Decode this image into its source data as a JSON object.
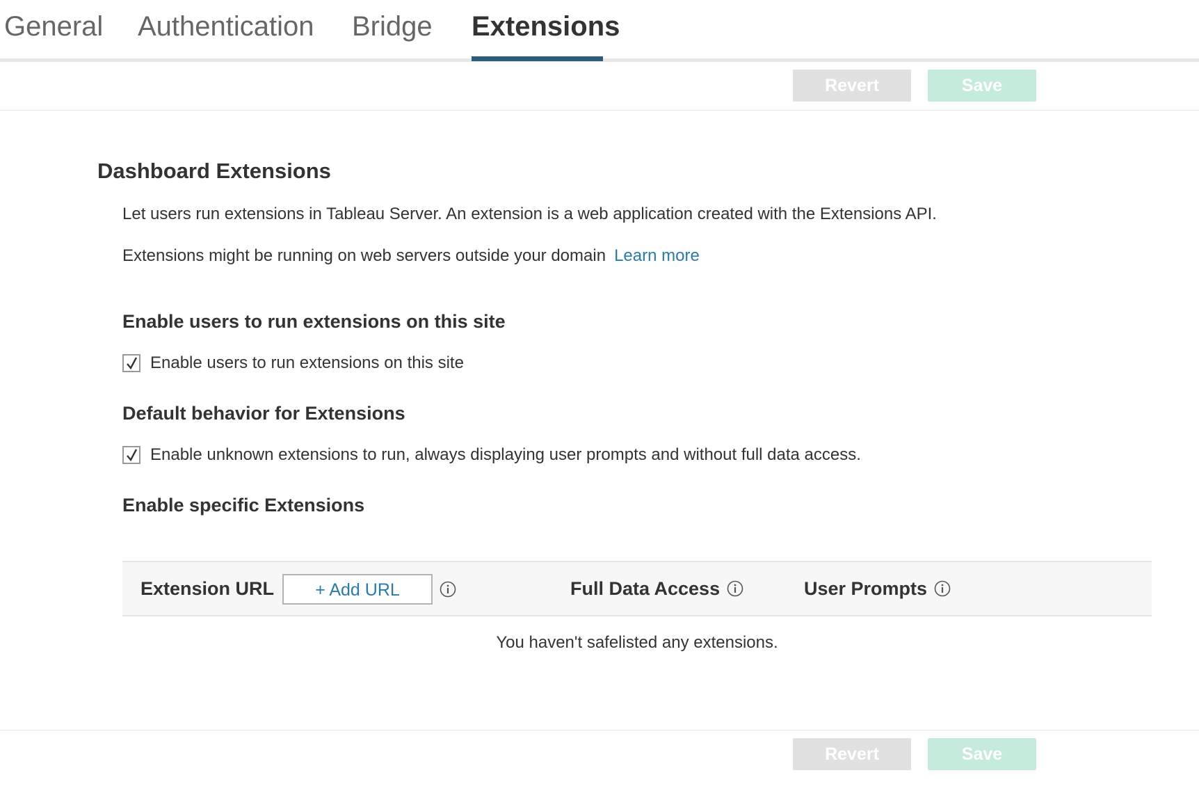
{
  "tabs": [
    {
      "label": "General",
      "active": false
    },
    {
      "label": "Authentication",
      "active": false
    },
    {
      "label": "Bridge",
      "active": false
    },
    {
      "label": "Extensions",
      "active": true
    }
  ],
  "actions": {
    "revert_label": "Revert",
    "save_label": "Save"
  },
  "section": {
    "title": "Dashboard Extensions",
    "description": "Let users run extensions in Tableau Server. An extension is a web application created with the Extensions API.",
    "notice": "Extensions might be running on web servers outside your domain",
    "learn_more": "Learn more"
  },
  "enable_users": {
    "heading": "Enable users to run extensions on this site",
    "checkbox_label": "Enable users to run extensions on this site",
    "checked": true
  },
  "default_behavior": {
    "heading": "Default behavior for Extensions",
    "checkbox_label": "Enable unknown extensions to run, always displaying user prompts and without full data access.",
    "checked": true
  },
  "specific": {
    "heading": "Enable specific Extensions"
  },
  "table": {
    "col_url": "Extension URL",
    "add_url_label": "+ Add URL",
    "col_full_data": "Full Data Access",
    "col_user_prompts": "User Prompts",
    "empty_message": "You haven't safelisted any extensions."
  },
  "colors": {
    "accent": "#2d5b7b",
    "link": "#2a7bab",
    "save_disabled": "#c5ebdd",
    "revert_disabled": "#e1e1e1"
  }
}
